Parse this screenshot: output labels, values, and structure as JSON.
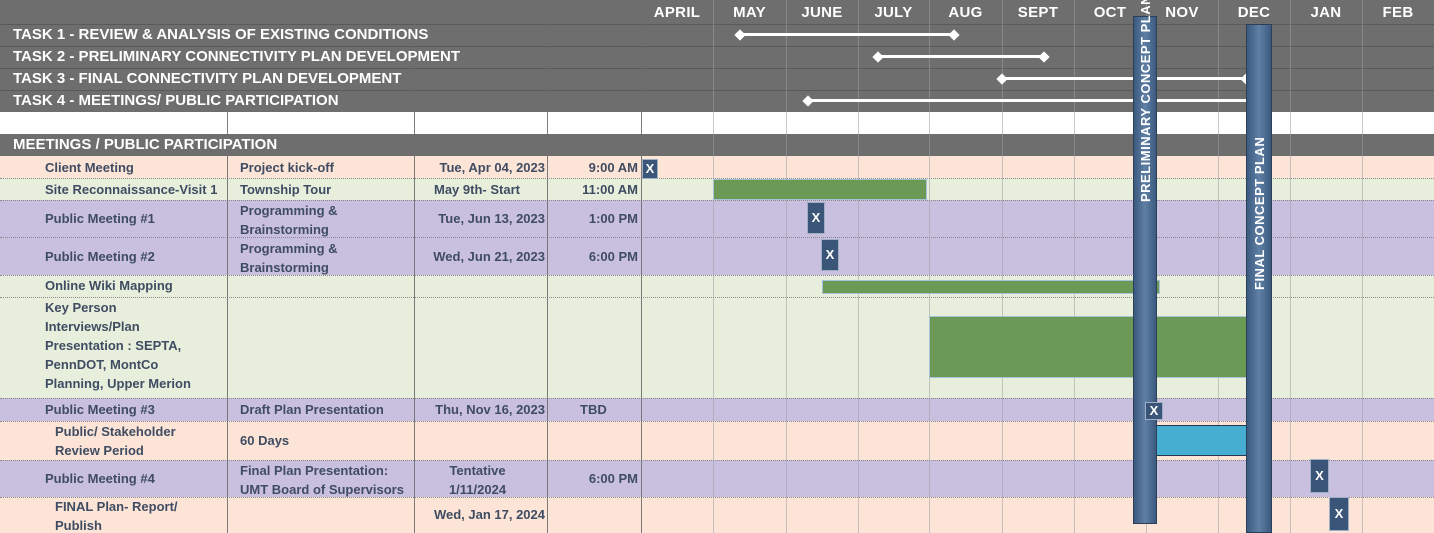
{
  "months": [
    "APRIL",
    "MAY",
    "JUNE",
    "JULY",
    "AUG",
    "SEPT",
    "OCT",
    "NOV",
    "DEC",
    "JAN",
    "FEB"
  ],
  "tasks": [
    {
      "label": "TASK 1 - REVIEW & ANALYSIS OF EXISTING CONDITIONS"
    },
    {
      "label": "TASK 2 - PRELIMINARY CONNECTIVITY PLAN DEVELOPMENT"
    },
    {
      "label": "TASK 3 - FINAL CONNECTIVITY PLAN DEVELOPMENT"
    },
    {
      "label": "TASK 4 - MEETINGS/ PUBLIC PARTICIPATION"
    }
  ],
  "section_header": "MEETINGS / PUBLIC PARTICIPATION",
  "rows": [
    {
      "name": "Client Meeting",
      "description": "Project kick-off",
      "date": "Tue, Apr 04, 2023",
      "time": "9:00 AM",
      "marker": "X"
    },
    {
      "name": "Site Reconnaissance-Visit 1",
      "description": "Township Tour",
      "date": "May 9th- Start",
      "time": "11:00 AM",
      "marker": ""
    },
    {
      "name": "Public Meeting #1",
      "description": "Programming & Brainstorming",
      "date": "Tue, Jun 13, 2023",
      "time": "1:00 PM",
      "marker": "X"
    },
    {
      "name": "Public Meeting #2",
      "description": "Programming & Brainstorming",
      "date": "Wed, Jun 21, 2023",
      "time": "6:00 PM",
      "marker": "X"
    },
    {
      "name": "Online Wiki Mapping",
      "description": "",
      "date": "",
      "time": "",
      "marker": ""
    },
    {
      "name": "Key Person Interviews/Plan Presentation : SEPTA, PennDOT, MontCo Planning, Upper Merion",
      "description": "",
      "date": "",
      "time": "",
      "marker": ""
    },
    {
      "name": "Public Meeting #3",
      "description": "Draft Plan Presentation",
      "date": "Thu, Nov 16, 2023",
      "time": "TBD",
      "marker": "X"
    },
    {
      "name": "Public/ Stakeholder Review Period",
      "description": "60 Days",
      "date": "",
      "time": "",
      "marker": ""
    },
    {
      "name": "Public Meeting #4",
      "description": "Final Plan Presentation: UMT Board of Supervisors",
      "date": "Tentative 1/11/2024",
      "time": "6:00 PM",
      "marker": "X"
    },
    {
      "name": "FINAL Plan- Report/ Publish",
      "description": "",
      "date": "Wed, Jan 17, 2024",
      "time": "",
      "marker": "X"
    }
  ],
  "milestones": {
    "preliminary": "PRELIMINARY CONCEPT PLAN",
    "final": "FINAL CONCEPT PLAN"
  },
  "colors": {
    "header_gray": "#6e6e6e",
    "row_peach": "#fce4d6",
    "row_green": "#e7efdc",
    "row_purple": "#c9bfdf",
    "bar_green": "#6b9a56",
    "bar_blue": "#46aed0",
    "milestone_blue": "#4a6890",
    "marker_navy": "#3b5578"
  }
}
